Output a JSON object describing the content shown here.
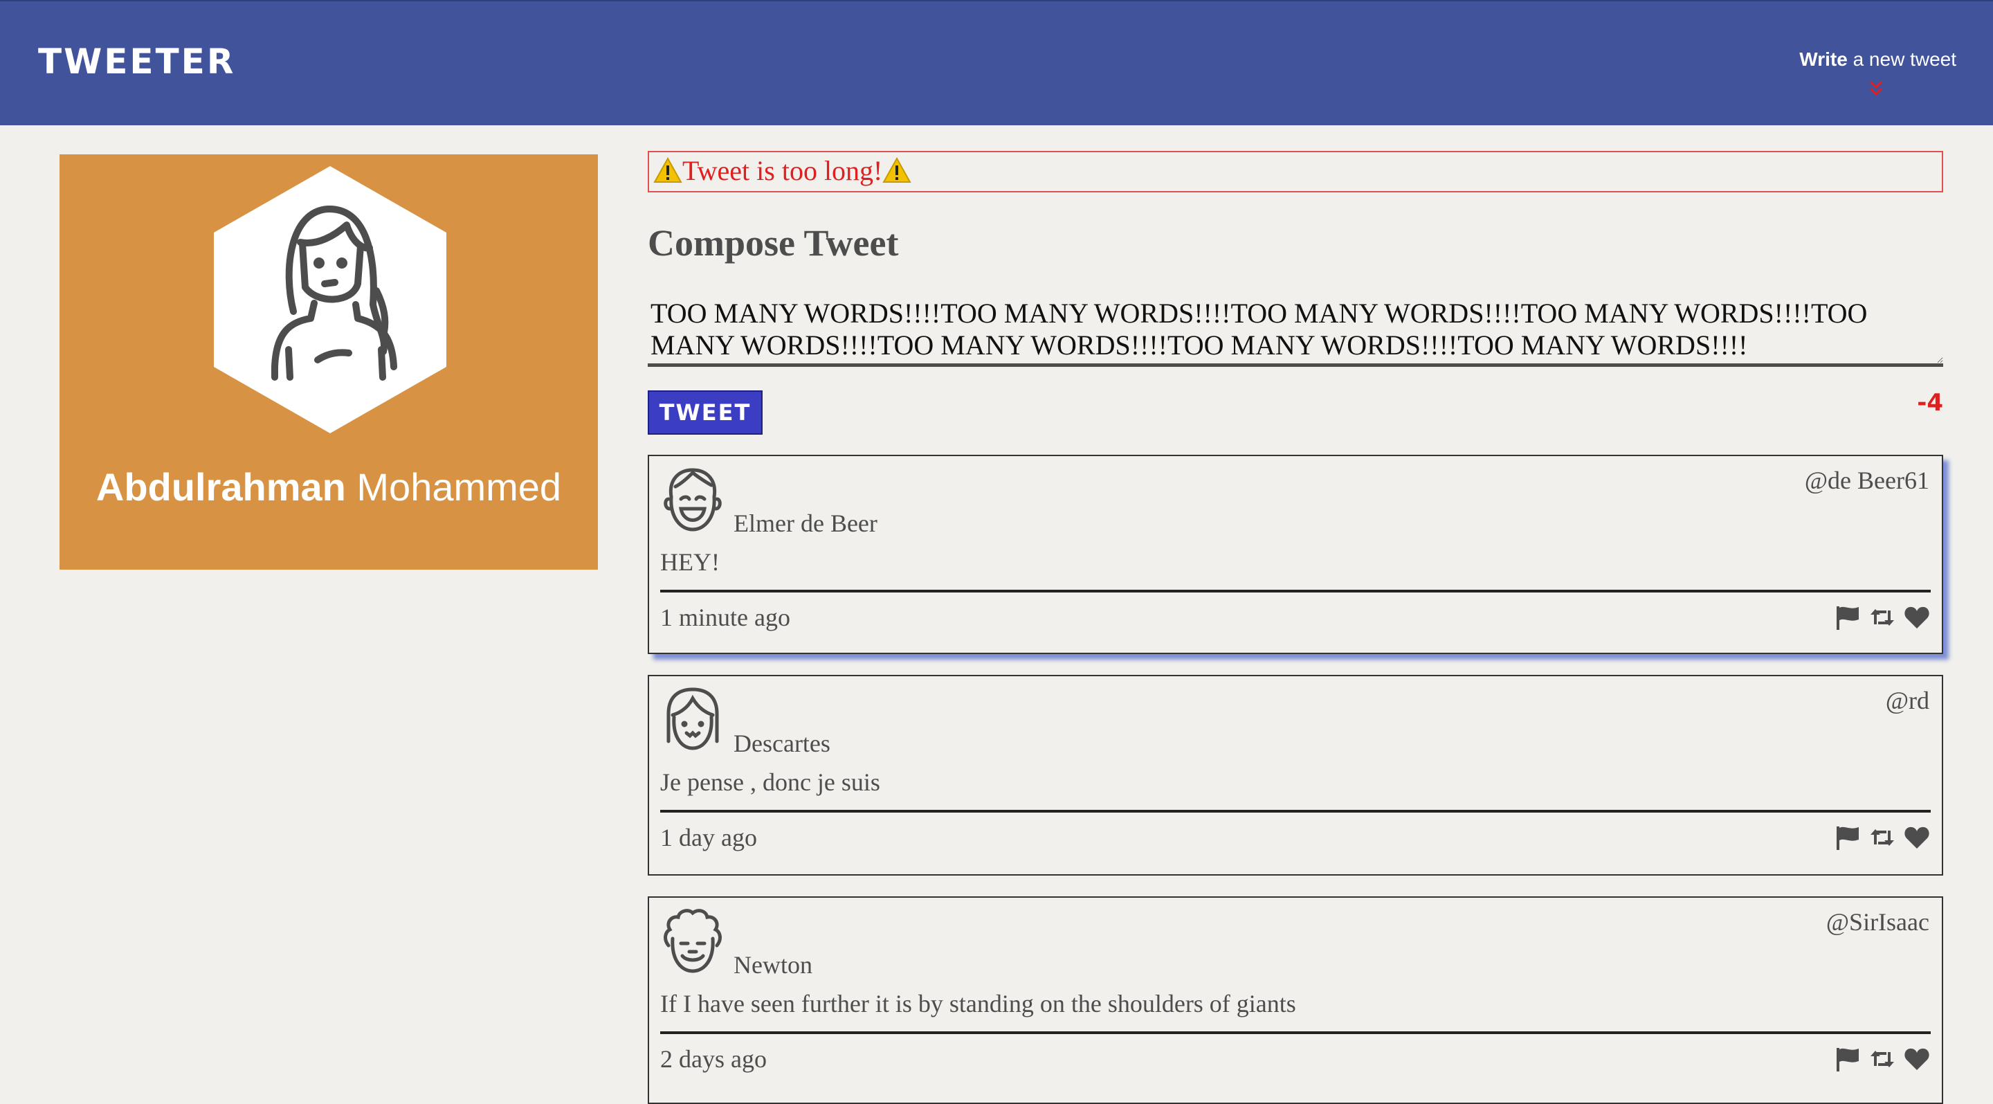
{
  "nav": {
    "brand": "TWEETER",
    "write_bold": "Write",
    "write_rest": " a new tweet"
  },
  "profile": {
    "first_name": "Abdulrahman",
    "last_name": " Mohammed"
  },
  "error": {
    "message": "Tweet is too long!"
  },
  "compose": {
    "title": "Compose Tweet",
    "text": "TOO MANY WORDS!!!!TOO MANY WORDS!!!!TOO MANY WORDS!!!!TOO MANY WORDS!!!!TOO MANY WORDS!!!!TOO MANY WORDS!!!!TOO MANY WORDS!!!!TOO MANY WORDS!!!!",
    "button_label": "TWEET",
    "counter": "-4"
  },
  "tweets": [
    {
      "name": "Elmer de Beer",
      "handle": "@de Beer61",
      "content": "HEY!",
      "time": "1 minute ago"
    },
    {
      "name": "Descartes",
      "handle": "@rd",
      "content": "Je pense , donc je suis",
      "time": "1 day ago"
    },
    {
      "name": "Newton",
      "handle": "@SirIsaac",
      "content": "If I have seen further it is by standing on the shoulders of giants",
      "time": "2 days ago"
    }
  ],
  "colors": {
    "nav_bg": "#41549b",
    "profile_bg": "#d79343",
    "error": "#e02020",
    "button": "#3b3ec2",
    "page_bg": "#f1f0ec"
  },
  "icons": [
    "warning-icon",
    "double-chevron-down-icon",
    "flag-icon",
    "retweet-icon",
    "heart-icon"
  ]
}
